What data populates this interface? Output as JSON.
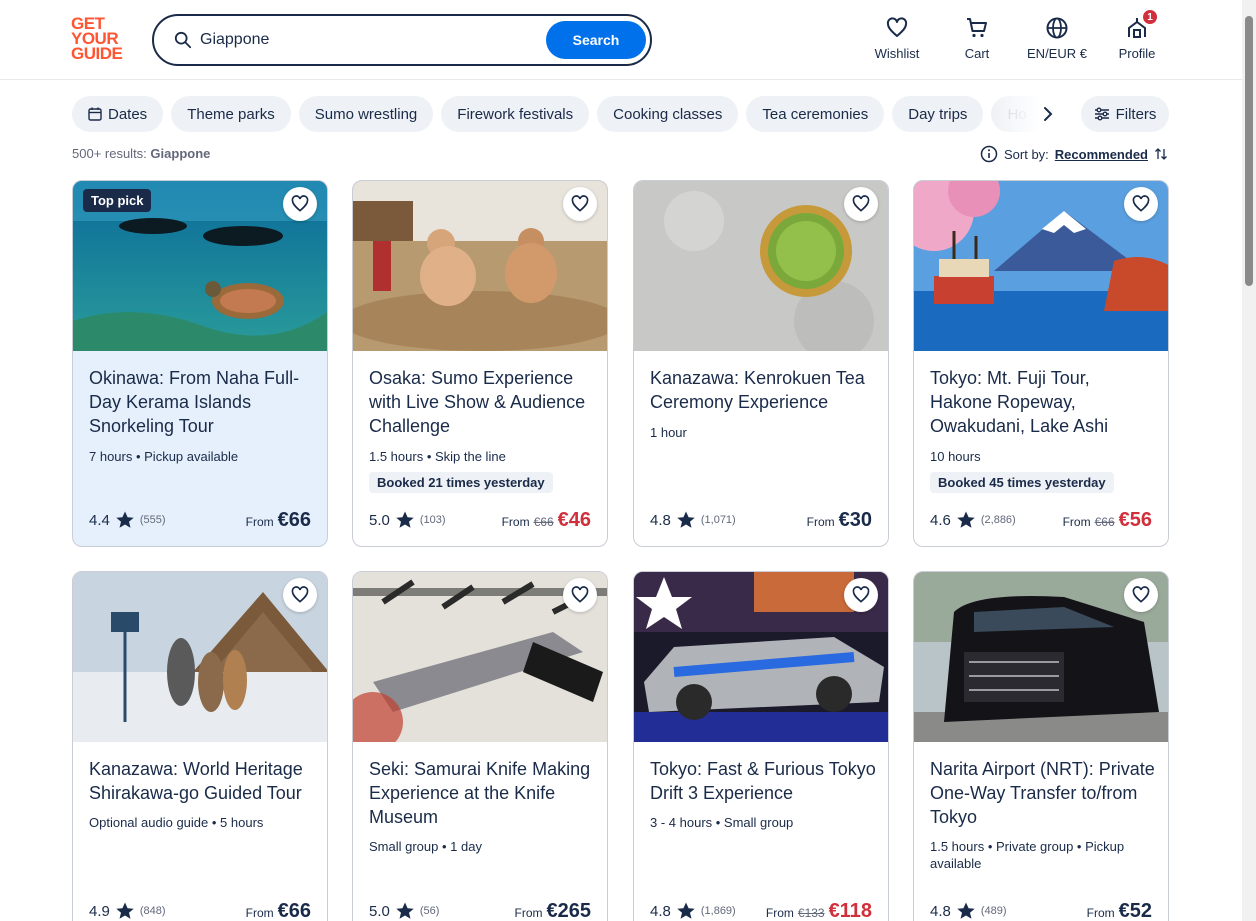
{
  "header": {
    "logo_lines": [
      "GET",
      "YOUR",
      "GUIDE"
    ],
    "search_value": "Giappone",
    "search_button": "Search",
    "nav": [
      {
        "label": "Wishlist",
        "icon": "heart-icon"
      },
      {
        "label": "Cart",
        "icon": "cart-icon"
      },
      {
        "label": "EN/EUR €",
        "icon": "globe-icon"
      },
      {
        "label": "Profile",
        "icon": "profile-icon",
        "badge": "1"
      }
    ]
  },
  "chips": [
    "Dates",
    "Theme parks",
    "Sumo wrestling",
    "Firework festivals",
    "Cooking classes",
    "Tea ceremonies",
    "Day trips",
    "Ho"
  ],
  "filters_label": "Filters",
  "results": {
    "count": "500+ results:",
    "query": "Giappone"
  },
  "sort": {
    "label": "Sort by:",
    "value": "Recommended"
  },
  "cards": [
    {
      "title": "Okinawa: From Naha Full-Day Kerama Islands Snorkeling Tour",
      "meta": "7 hours • Pickup available",
      "booked": "",
      "rating": "4.4",
      "count": "(555)",
      "from": "From",
      "old": "",
      "price": "€66",
      "tag": "Top pick",
      "highlight": true
    },
    {
      "title": "Osaka: Sumo Experience with Live Show & Audience Challenge",
      "meta": "1.5 hours • Skip the line",
      "booked": "Booked 21 times yesterday",
      "rating": "5.0",
      "count": "(103)",
      "from": "From",
      "old": "€66",
      "price": "€46",
      "tag": ""
    },
    {
      "title": "Kanazawa: Kenrokuen Tea Ceremony Experience",
      "meta": "1 hour",
      "booked": "",
      "rating": "4.8",
      "count": "(1,071)",
      "from": "From",
      "old": "",
      "price": "€30",
      "tag": ""
    },
    {
      "title": "Tokyo: Mt. Fuji Tour, Hakone Ropeway, Owakudani, Lake Ashi",
      "meta": "10 hours",
      "booked": "Booked 45 times yesterday",
      "rating": "4.6",
      "count": "(2,886)",
      "from": "From",
      "old": "€66",
      "price": "€56",
      "tag": ""
    },
    {
      "title": "Kanazawa: World Heritage Shirakawa-go Guided Tour",
      "meta": "Optional audio guide • 5 hours",
      "booked": "",
      "rating": "4.9",
      "count": "(848)",
      "from": "From",
      "old": "",
      "price": "€66",
      "tag": ""
    },
    {
      "title": "Seki: Samurai Knife Making Experience at the Knife Museum",
      "meta": "Small group • 1 day",
      "booked": "",
      "rating": "5.0",
      "count": "(56)",
      "from": "From",
      "old": "",
      "price": "€265",
      "tag": ""
    },
    {
      "title": "Tokyo: Fast & Furious Tokyo Drift 3 Experience",
      "meta": "3 - 4 hours • Small group",
      "booked": "",
      "rating": "4.8",
      "count": "(1,869)",
      "from": "From",
      "old": "€133",
      "price": "€118",
      "tag": ""
    },
    {
      "title": "Narita Airport (NRT): Private One-Way Transfer to/from Tokyo",
      "meta": "1.5 hours • Private group • Pickup available",
      "booked": "",
      "rating": "4.8",
      "count": "(489)",
      "from": "From",
      "old": "",
      "price": "€52",
      "tag": ""
    }
  ],
  "colors": {
    "brand": "#ff5533",
    "accent": "#0071eb",
    "text": "#1a2b49",
    "sale": "#d02f3c",
    "highlight": "#e6f0fc"
  }
}
